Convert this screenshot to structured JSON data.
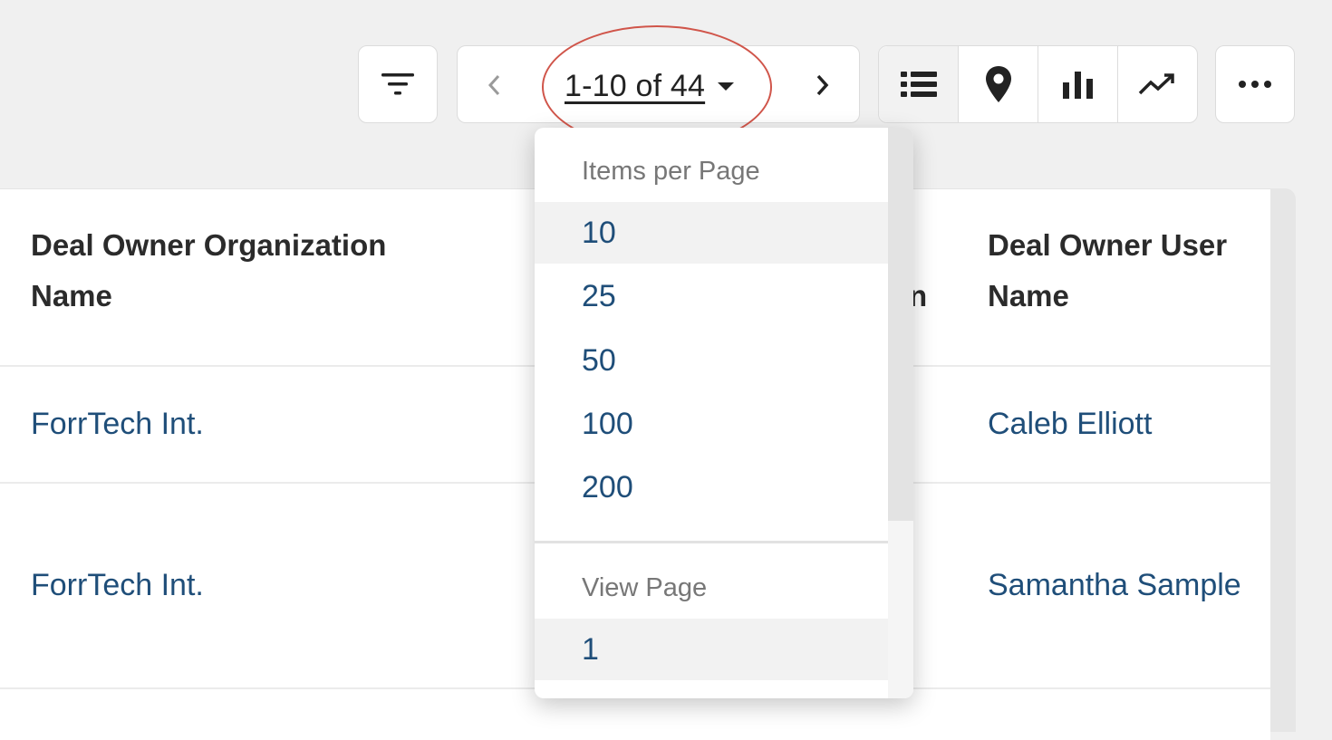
{
  "toolbar": {
    "filter_icon": "filter-icon",
    "pagination": {
      "range_label": "1-10 of 44",
      "prev_icon": "chevron-left-icon",
      "next_icon": "chevron-right-icon",
      "caret_icon": "caret-down-icon"
    },
    "view_icons": [
      "list-icon",
      "map-pin-icon",
      "bar-chart-icon",
      "trend-line-icon"
    ],
    "active_view": "list-icon",
    "more_icon": "more-horizontal-icon"
  },
  "table": {
    "columns": [
      {
        "line1": "Deal Owner Organization",
        "line2": "Name"
      },
      {
        "line1": "",
        "line2": "n"
      },
      {
        "line1": "Deal Owner User",
        "line2": "Name"
      }
    ],
    "rows": [
      {
        "org": "ForrTech Int.",
        "user": "Caleb Elliott"
      },
      {
        "org": "ForrTech Int.",
        "user": "Samantha Sample"
      }
    ]
  },
  "dropdown": {
    "items_per_page_label": "Items per Page",
    "items_per_page_options": [
      "10",
      "25",
      "50",
      "100",
      "200"
    ],
    "selected_items_per_page": "10",
    "view_page_label": "View Page",
    "view_page_options": [
      "1"
    ],
    "selected_page": "1"
  },
  "colors": {
    "link": "#1f4e79",
    "highlight_ring": "#d0554a"
  }
}
